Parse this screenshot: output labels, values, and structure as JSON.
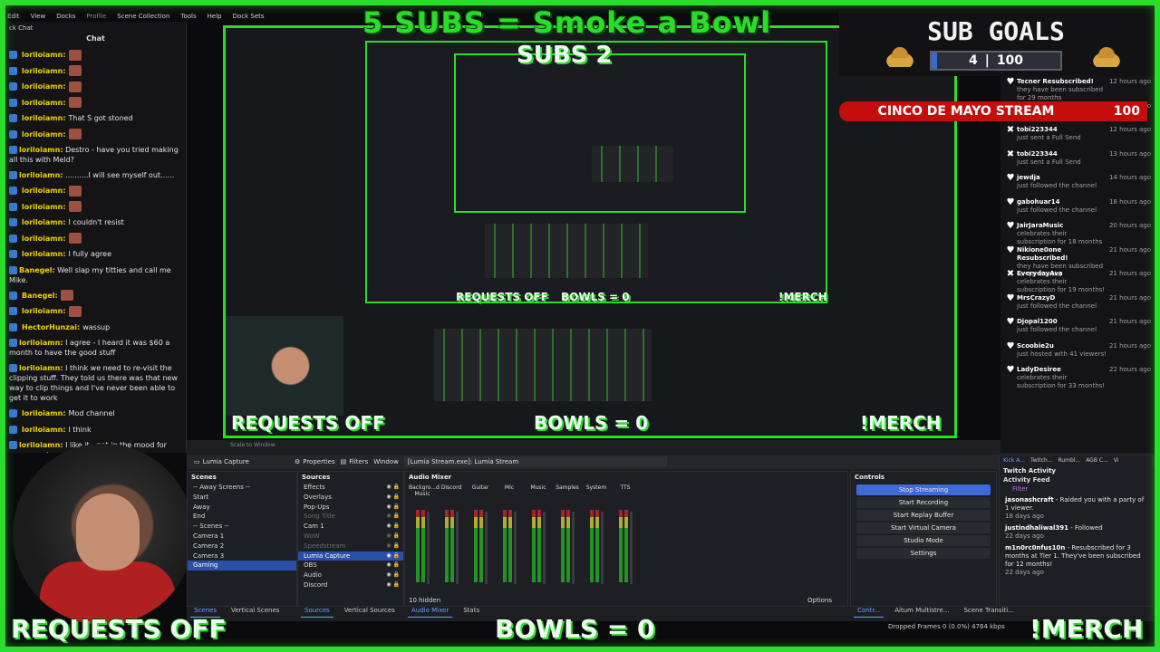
{
  "menu": [
    "Edit",
    "View",
    "Docks",
    "Profile",
    "Scene Collection",
    "Tools",
    "Help",
    "Dock Sets"
  ],
  "chat": {
    "dock_label": "ck Chat",
    "title": "Chat",
    "messages": [
      {
        "user": "loriloiamn:",
        "text": ""
      },
      {
        "user": "loriloiamn:",
        "text": ""
      },
      {
        "user": "loriloiamn:",
        "text": ""
      },
      {
        "user": "loriloiamn:",
        "text": ""
      },
      {
        "user": "loriloiamn:",
        "text": "That S got stoned"
      },
      {
        "user": "loriloiamn:",
        "text": ""
      },
      {
        "user": "loriloiamn:",
        "text": "Destro - have you tried making all this with Meld?"
      },
      {
        "user": "loriloiamn:",
        "text": "..........I will see myself out......"
      },
      {
        "user": "loriloiamn:",
        "text": ""
      },
      {
        "user": "loriloiamn:",
        "text": ""
      },
      {
        "user": "loriloiamn:",
        "text": "I couldn't resist"
      },
      {
        "user": "loriloiamn:",
        "text": ""
      },
      {
        "user": "loriloiamn:",
        "text": "I fully agree"
      },
      {
        "user": "Banegel:",
        "text": "Well slap my titties and call me Mike."
      },
      {
        "user": "Banegel:",
        "text": ""
      },
      {
        "user": "loriloiamn:",
        "text": ""
      },
      {
        "user": "HectorHunzai:",
        "text": "wassup"
      },
      {
        "user": "loriloiamn:",
        "text": "I agree - I heard it was $60 a month to have the good stuff"
      },
      {
        "user": "loriloiamn:",
        "text": "I think we need to re-visit the clipping stuff. They told us there was that new way to clip things and I've never been able to get it to work"
      },
      {
        "user": "loriloiamn:",
        "text": "Mod channel"
      },
      {
        "user": "loriloiamn:",
        "text": "I think"
      },
      {
        "user": "loriloiamn:",
        "text": "I like it - not in the mood for crazy music."
      }
    ]
  },
  "overlay": {
    "title": "5 SUBS = Smoke a Bowl",
    "subtitle": "SUBS 2",
    "requests": "REQUESTS OFF",
    "bowls": "BOWLS = 0",
    "merch": "!MERCH"
  },
  "sub_goals": {
    "label": "SUB GOALS",
    "current": "4",
    "sep": "|",
    "target": "100",
    "progress": 0.04
  },
  "cinco": {
    "text": "CINCO DE MAYO STREAM",
    "value": "100"
  },
  "activity": [
    {
      "icon": "♥",
      "who": "Tecner Resubscribed!",
      "what": "they have been subscribed for 29 months",
      "when": "12 hours ago"
    },
    {
      "icon": "♥",
      "who": "",
      "what": "",
      "when": "12 hours ago"
    },
    {
      "icon": "✖",
      "who": "tobi223344",
      "what": "just sent a Full Send",
      "when": "12 hours ago"
    },
    {
      "icon": "✖",
      "who": "tobi223344",
      "what": "just sent a Full Send",
      "when": "13 hours ago"
    },
    {
      "icon": "♥",
      "who": "jewdja",
      "what": "just followed the channel",
      "when": "14 hours ago"
    },
    {
      "icon": "♥",
      "who": "gabohuar14",
      "what": "just followed the channel",
      "when": "18 hours ago"
    },
    {
      "icon": "♥",
      "who": "JairJaraMusic",
      "what": "celebrates their subscription for 18 months",
      "when": "20 hours ago"
    },
    {
      "icon": "♥",
      "who": "Nikione0one Resubscribed!",
      "what": "they have been subscribed for 18 months",
      "when": "21 hours ago"
    },
    {
      "icon": "✖",
      "who": "EverydayAva",
      "what": "celebrates their subscription for 19 months!",
      "when": "21 hours ago"
    },
    {
      "icon": "♥",
      "who": "MrsCrazyD",
      "what": "just followed the channel",
      "when": "21 hours ago"
    },
    {
      "icon": "♥",
      "who": "Djopal1200",
      "what": "just followed the channel",
      "when": "21 hours ago"
    },
    {
      "icon": "♥",
      "who": "Scoobie2u",
      "what": "just hosted with 41 viewers!",
      "when": "21 hours ago"
    },
    {
      "icon": "♥",
      "who": "LadyDesiree",
      "what": "celebrates their subscription for 33 months!",
      "when": "22 hours ago"
    }
  ],
  "obs": {
    "topbar": {
      "source": "Lumia Capture",
      "properties": "Properties",
      "filters": "Filters",
      "window_label": "Window",
      "window_value": "[Lumia Stream.exe]: Lumia Stream",
      "preview_label": "Scale to Window"
    },
    "scenes_title": "Scenes",
    "scenes": [
      "-- Away Screens --",
      "Start",
      "Away",
      "End",
      "-- Scenes --",
      "Camera 1",
      "Camera 2",
      "Camera 3",
      "Gaming"
    ],
    "sources_title": "Sources",
    "sources": [
      {
        "name": "Effects",
        "dim": false
      },
      {
        "name": "Overlays",
        "dim": false
      },
      {
        "name": "Pop-Ups",
        "dim": false
      },
      {
        "name": "Song Title",
        "dim": true
      },
      {
        "name": "Cam 1",
        "dim": false
      },
      {
        "name": "WoW",
        "dim": true
      },
      {
        "name": "Speedstream",
        "dim": true
      },
      {
        "name": "Lumia Capture",
        "dim": false,
        "selected": true
      },
      {
        "name": "OBS",
        "dim": false
      },
      {
        "name": "Audio",
        "dim": false
      },
      {
        "name": "Discord",
        "dim": false
      }
    ],
    "mixer_title": "Audio Mixer",
    "mixer_channels": [
      "Backgro...d Music",
      "Discord",
      "Guitar",
      "Mic",
      "Music",
      "Samples",
      "System",
      "TTS"
    ],
    "hidden_label": "10 hidden",
    "options_label": "Options",
    "controls_title": "Controls",
    "controls": [
      {
        "label": "Stop Streaming",
        "on": true
      },
      {
        "label": "Start Recording",
        "on": false
      },
      {
        "label": "Start Replay Buffer",
        "on": false
      },
      {
        "label": "Start Virtual Camera",
        "on": false
      },
      {
        "label": "Studio Mode",
        "on": false
      },
      {
        "label": "Settings",
        "on": false
      }
    ],
    "tabs_left": [
      "Scenes",
      "Vertical Scenes"
    ],
    "tabs_mid": [
      "Sources",
      "Vertical Sources"
    ],
    "tabs_mixer": [
      "Audio Mixer",
      "Stats"
    ],
    "tabs_right": [
      "Contr...",
      "Aitum Multistre...",
      "Scene Transiti..."
    ],
    "feed_tabs": [
      "Kick A...",
      "Twitch...",
      "Rumbl...",
      "AGB C...",
      "Vi"
    ],
    "feed_title": "Twitch Activity",
    "feed_sub": "Activity Feed",
    "feed_filter": "Filter",
    "feed_items": [
      {
        "who": "jasonashcraft",
        "text": "Raided you with a party of 1 viewer.",
        "when": "18 days ago"
      },
      {
        "who": "justindhaliwal391",
        "text": "Followed",
        "when": "22 days ago"
      },
      {
        "who": "m1n0rc0nfus10n",
        "text": "Resubscribed for 3 months at Tier 1. They've been subscribed for 12 months!",
        "when": "22 days ago"
      }
    ],
    "status": "Dropped Frames 0 (0.0%)   4764 kbps"
  },
  "colors": {
    "accent_green": "#2bdc2b",
    "obs_blue": "#3f6bd6",
    "username": "#f0d000",
    "cinco_red": "#c40e0e"
  }
}
